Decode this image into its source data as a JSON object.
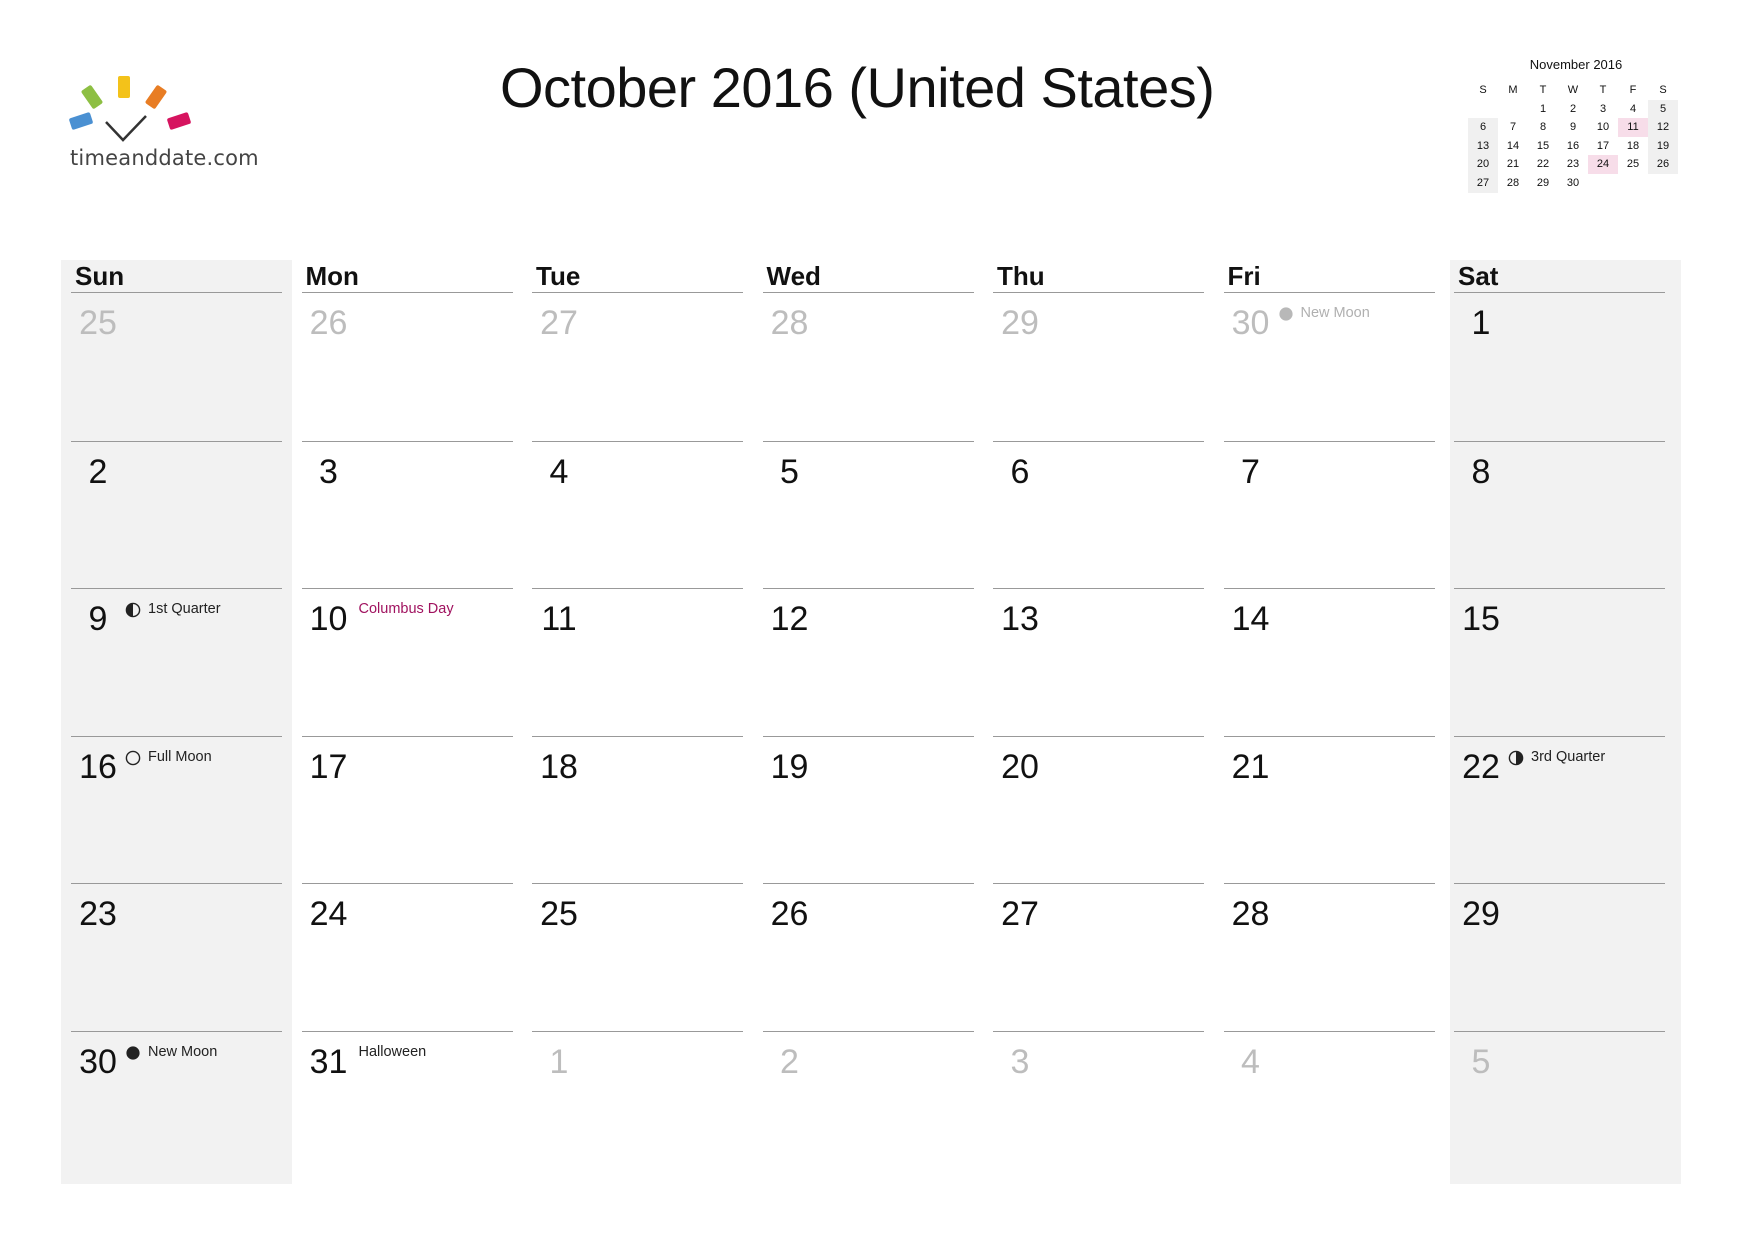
{
  "logo": {
    "text": "timeanddate.com"
  },
  "title": "October 2016 (United States)",
  "mini_calendar": {
    "title": "November 2016",
    "headers": [
      "S",
      "M",
      "T",
      "W",
      "T",
      "F",
      "S"
    ],
    "weeks": [
      [
        "",
        "",
        "1",
        "2",
        "3",
        "4",
        "5"
      ],
      [
        "6",
        "7",
        "8",
        "9",
        "10",
        "11",
        "12"
      ],
      [
        "13",
        "14",
        "15",
        "16",
        "17",
        "18",
        "19"
      ],
      [
        "20",
        "21",
        "22",
        "23",
        "24",
        "25",
        "26"
      ],
      [
        "27",
        "28",
        "29",
        "30",
        "",
        "",
        ""
      ]
    ],
    "highlighted": [
      "11",
      "24"
    ],
    "highlight_color": "#f7dde9"
  },
  "calendar": {
    "weekdays": [
      "Sun",
      "Mon",
      "Tue",
      "Wed",
      "Thu",
      "Fri",
      "Sat"
    ],
    "weekend_color": "#f2f2f2",
    "holiday_color": "#a0125f",
    "weeks": [
      [
        {
          "day": "25",
          "other": true
        },
        {
          "day": "26",
          "other": true
        },
        {
          "day": "27",
          "other": true
        },
        {
          "day": "28",
          "other": true
        },
        {
          "day": "29",
          "other": true
        },
        {
          "day": "30",
          "other": true,
          "event": "New Moon",
          "moon": "new",
          "muted": true
        },
        {
          "day": "1"
        }
      ],
      [
        {
          "day": "2"
        },
        {
          "day": "3"
        },
        {
          "day": "4"
        },
        {
          "day": "5"
        },
        {
          "day": "6"
        },
        {
          "day": "7"
        },
        {
          "day": "8"
        }
      ],
      [
        {
          "day": "9",
          "event": "1st Quarter",
          "moon": "first-quarter"
        },
        {
          "day": "10",
          "event": "Columbus Day",
          "holiday": true
        },
        {
          "day": "11"
        },
        {
          "day": "12"
        },
        {
          "day": "13"
        },
        {
          "day": "14"
        },
        {
          "day": "15"
        }
      ],
      [
        {
          "day": "16",
          "event": "Full Moon",
          "moon": "full"
        },
        {
          "day": "17"
        },
        {
          "day": "18"
        },
        {
          "day": "19"
        },
        {
          "day": "20"
        },
        {
          "day": "21"
        },
        {
          "day": "22",
          "event": "3rd Quarter",
          "moon": "third-quarter"
        }
      ],
      [
        {
          "day": "23"
        },
        {
          "day": "24"
        },
        {
          "day": "25"
        },
        {
          "day": "26"
        },
        {
          "day": "27"
        },
        {
          "day": "28"
        },
        {
          "day": "29"
        }
      ],
      [
        {
          "day": "30",
          "event": "New Moon",
          "moon": "new"
        },
        {
          "day": "31",
          "event": "Halloween"
        },
        {
          "day": "1",
          "other": true
        },
        {
          "day": "2",
          "other": true
        },
        {
          "day": "3",
          "other": true
        },
        {
          "day": "4",
          "other": true
        },
        {
          "day": "5",
          "other": true
        }
      ]
    ]
  }
}
